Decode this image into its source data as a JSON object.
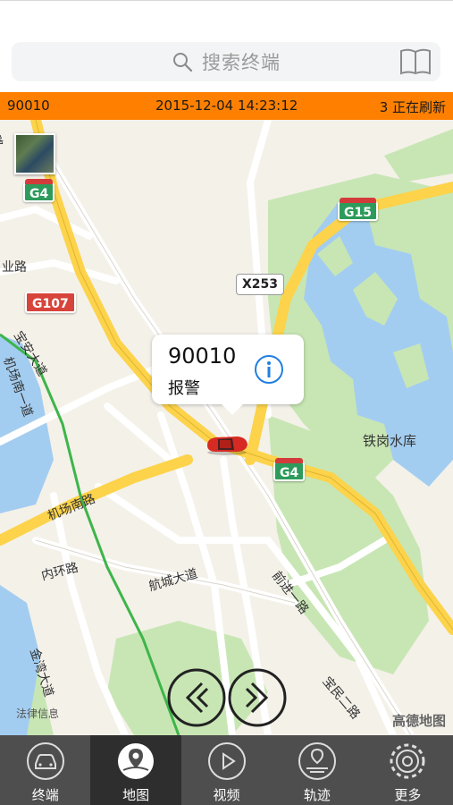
{
  "search": {
    "placeholder": "搜索终端",
    "icon": "search-icon",
    "book_icon": "book-icon"
  },
  "status": {
    "vehicle_id": "90010",
    "datetime": "2015-12-04 14:23:12",
    "refresh": "3 正在刷新"
  },
  "map": {
    "shields": {
      "g4_top": "G4",
      "g15": "G15",
      "x253": "X253",
      "g107": "G107",
      "g4_mid": "G4"
    },
    "labels": {
      "road_bao_an": "宝安大道",
      "road_airport_south_1": "机场南一道",
      "road_airport_south": "机场南路",
      "road_inner_ring": "内环路",
      "road_hangcheng": "航城大道",
      "road_qianjin": "前进一路",
      "road_jinwan": "金湾大道",
      "road_baomin": "宝民二路",
      "reservoir": "铁岗水库",
      "road_ye": "业路",
      "road_top": "环路"
    },
    "callout": {
      "title": "90010",
      "subtitle": "报警"
    },
    "legal": "法律信息",
    "provider": "高德地图",
    "colors": {
      "water": "#a3cdf0",
      "green": "#c8e6b4",
      "highway": "#fcd34a",
      "road": "#ffffff"
    }
  },
  "tabs": [
    {
      "label": "终端",
      "icon": "car-icon"
    },
    {
      "label": "地图",
      "icon": "map-pin-icon"
    },
    {
      "label": "视频",
      "icon": "play-icon"
    },
    {
      "label": "轨迹",
      "icon": "track-icon"
    },
    {
      "label": "更多",
      "icon": "gear-icon"
    }
  ],
  "active_tab": "地图"
}
